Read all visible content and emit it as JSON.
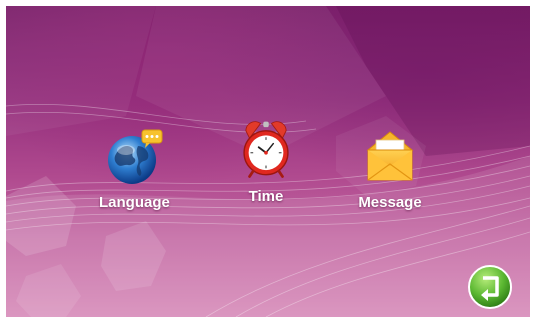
{
  "menu": {
    "items": [
      {
        "label": "Language",
        "icon": "globe-chat-icon"
      },
      {
        "label": "Time",
        "icon": "alarm-clock-icon"
      },
      {
        "label": "Message",
        "icon": "envelope-icon"
      }
    ]
  },
  "back_button": {
    "icon": "back-arrow-icon"
  },
  "colors": {
    "background_top": "#7b1f6a",
    "background_bottom": "#d78bb9",
    "back_button": "#5cb832",
    "label_text": "#ffffff"
  }
}
